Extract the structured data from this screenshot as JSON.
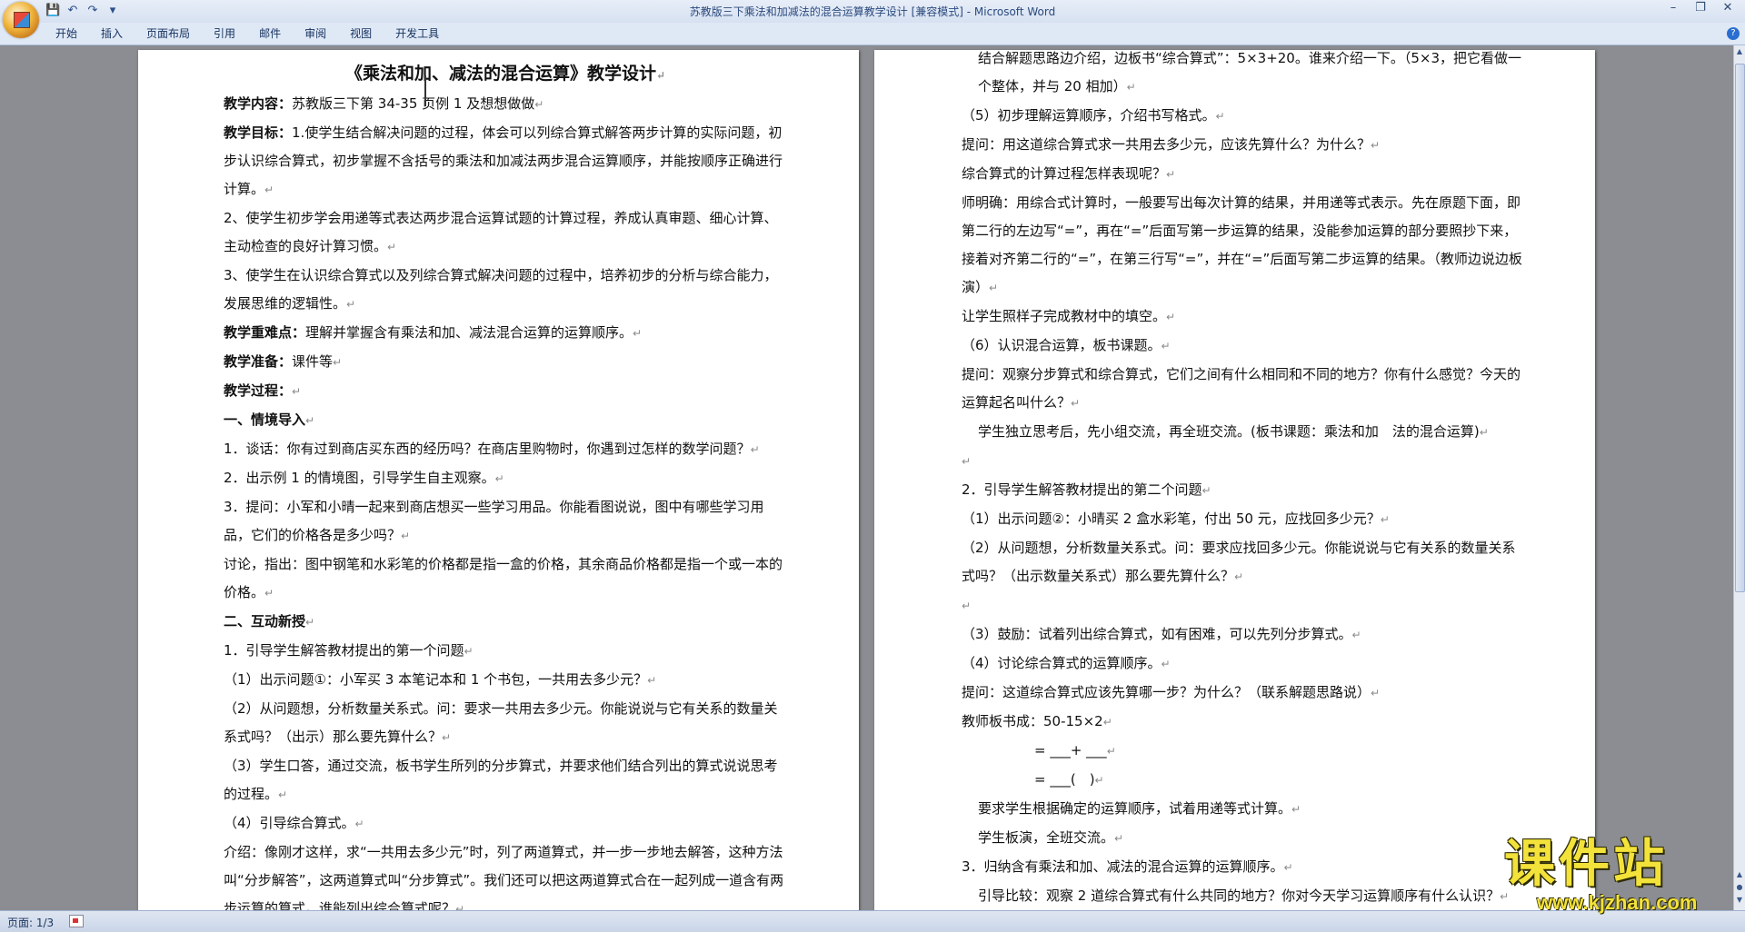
{
  "window": {
    "title": "苏教版三下乘法和加减法的混合运算教学设计 [兼容模式] - Microsoft Word"
  },
  "quick_access": [
    "save-icon",
    "undo-icon",
    "redo-icon",
    "customize-icon"
  ],
  "ribbon": {
    "tabs": [
      "开始",
      "插入",
      "页面布局",
      "引用",
      "邮件",
      "审阅",
      "视图",
      "开发工具"
    ]
  },
  "document": {
    "title": "《乘法和加、减法的混合运算》教学设计",
    "left_page": [
      {
        "label": "教学内容：",
        "text": "苏教版三下第 34-35 页例 1 及想想做做"
      },
      {
        "label": "教学目标：",
        "text": "1.使学生结合解决问题的过程，体会可以列综合算式解答两步计算的实际问题，初步认识综合算式，初步掌握不含括号的乘法和加减法两步混合运算顺序，并能按顺序正确进行计算。"
      },
      {
        "label": "",
        "text": "2、使学生初步学会用递等式表达两步混合运算试题的计算过程，养成认真审题、细心计算、主动检查的良好计算习惯。"
      },
      {
        "label": "",
        "text": "3、使学生在认识综合算式以及列综合算式解决问题的过程中，培养初步的分析与综合能力，发展思维的逻辑性。"
      },
      {
        "label": "教学重难点：",
        "text": "理解并掌握含有乘法和加、减法混合运算的运算顺序。"
      },
      {
        "label": "教学准备：",
        "text": "课件等"
      },
      {
        "label": "教学过程：",
        "text": ""
      },
      {
        "label": "一、情境导入",
        "text": ""
      },
      {
        "label": "",
        "text": "1．谈话：你有过到商店买东西的经历吗？在商店里购物时，你遇到过怎样的数学问题？"
      },
      {
        "label": "",
        "text": "2．出示例 1 的情境图，引导学生自主观察。"
      },
      {
        "label": "",
        "text": "3．提问：小军和小晴一起来到商店想买一些学习用品。你能看图说说，图中有哪些学习用品，它们的价格各是多少吗？"
      },
      {
        "label": "",
        "text": "讨论，指出：图中钢笔和水彩笔的价格都是指一盒的价格，其余商品价格都是指一个或一本的价格。"
      },
      {
        "label": "二、互动新授",
        "text": ""
      },
      {
        "label": "",
        "text": "1．引导学生解答教材提出的第一个问题"
      },
      {
        "label": "",
        "text": "（1）出示问题①：小军买 3 本笔记本和 1 个书包，一共用去多少元？"
      },
      {
        "label": "",
        "text": "（2）从问题想，分析数量关系式。问：要求一共用去多少元。你能说说与它有关系的数量关系式吗？（出示）那么要先算什么？"
      },
      {
        "label": "",
        "text": "（3）学生口答，通过交流，板书学生所列的分步算式，并要求他们结合列出的算式说说思考的过程。"
      },
      {
        "label": "",
        "text": "（4）引导综合算式。"
      },
      {
        "label": "",
        "text": "介绍：像刚才这样，求“一共用去多少元”时，列了两道算式，并一步一步地去解答，这种方法叫“分步解答”，这两道算式叫“分步算式”。我们还可以把这两道算式合在一起列成一道含有两步运算的算式。谁能列出综合算式呢？"
      }
    ],
    "right_page": [
      {
        "text": "结合解题思路边介绍，边板书“综合算式”：5×3+20。谁来介绍一下。（5×3，把它看做一个整体，并与 20 相加）"
      },
      {
        "text": "（5）初步理解运算顺序，介绍书写格式。"
      },
      {
        "text": "提问：用这道综合算式求一共用去多少元，应该先算什么？为什么？"
      },
      {
        "text": "综合算式的计算过程怎样表现呢？"
      },
      {
        "text": "师明确：用综合式计算时，一般要写出每次计算的结果，并用递等式表示。先在原题下面，即第二行的左边写“=”，再在“=”后面写第一步运算的结果，没能参加运算的部分要照抄下来，接着对齐第二行的“=”，在第三行写“=”，并在“=”后面写第二步运算的结果。（教师边说边板演）"
      },
      {
        "text": "让学生照样子完成教材中的填空。"
      },
      {
        "text": "（6）认识混合运算，板书课题。"
      },
      {
        "text": "提问：观察分步算式和综合算式，它们之间有什么相同和不同的地方？你有什么感觉？今天的运算起名叫什么？"
      },
      {
        "text": "学生独立思考后，先小组交流，再全班交流。(板书课题：乘法和加　法的混合运算)"
      },
      {
        "text": ""
      },
      {
        "text": "2．引导学生解答教材提出的第二个问题"
      },
      {
        "text": "（1）出示问题②：小晴买 2 盒水彩笔，付出 50 元，应找回多少元？"
      },
      {
        "text": "（2）从问题想，分析数量关系式。问：要求应找回多少元。你能说说与它有关系的数量关系式吗？（出示数量关系式）那么要先算什么？"
      },
      {
        "text": ""
      },
      {
        "text": "（3）鼓励：试着列出综合算式，如有困难，可以先列分步算式。"
      },
      {
        "text": "（4）讨论综合算式的运算顺序。"
      },
      {
        "text": "提问：这道综合算式应该先算哪一步？为什么？（联系解题思路说）"
      },
      {
        "text": "教师板书成：50-15×2"
      },
      {
        "text": "= ___+ ___"
      },
      {
        "text": "= ___(　)"
      },
      {
        "text": "要求学生根据确定的运算顺序，试着用递等式计算。"
      },
      {
        "text": "学生板演，全班交流。"
      },
      {
        "text": "3．归纳含有乘法和加、减法的混合运算的运算顺序。"
      },
      {
        "text": "引导比较：观察 2 道综合算式有什么共同的地方？你对今天学习运算顺序有什么认识？"
      }
    ]
  },
  "status": {
    "page_info": "页面: 1/3"
  },
  "watermark": {
    "title": "课件站",
    "url": "www.kjzhan.com"
  }
}
